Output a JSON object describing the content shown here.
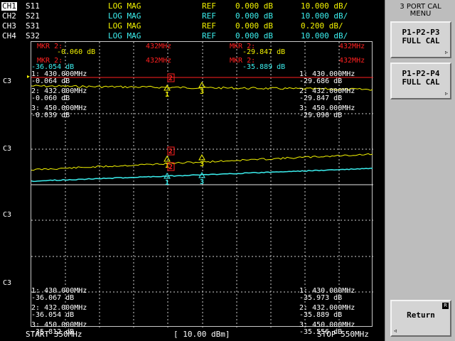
{
  "channels": [
    {
      "id": "CH1",
      "param": "S11",
      "format": "LOG MAG",
      "ref_label": "REF",
      "ref_value": "0.000 dB",
      "scale": "10.000 dB/",
      "color": "#f4f400"
    },
    {
      "id": "CH2",
      "param": "S21",
      "format": "LOG MAG",
      "ref_label": "REF",
      "ref_value": "0.000 dB",
      "scale": "10.000 dB/",
      "color": "#3cf0f0"
    },
    {
      "id": "CH3",
      "param": "S31",
      "format": "LOG MAG",
      "ref_label": "REF",
      "ref_value": "0.000 dB",
      "scale": "0.200 dB/",
      "color": "#f4f400"
    },
    {
      "id": "CH4",
      "param": "S32",
      "format": "LOG MAG",
      "ref_label": "REF",
      "ref_value": "0.000 dB",
      "scale": "10.000 dB/",
      "color": "#3cf0f0"
    }
  ],
  "active_markers": {
    "left_top": {
      "label": "MKR 2:",
      "freq": "432MHz",
      "value": "-0.060 dB"
    },
    "left_bottom": {
      "label": "MKR 2:",
      "freq": "432MHz",
      "value": "-36.054 dB"
    },
    "right_top": {
      "label": "MKR 2:",
      "freq": "432MHz",
      "value": "-29.847 dB"
    },
    "right_bottom": {
      "label": "MKR 2:",
      "freq": "432MHz",
      "value": "-35.889 dB"
    }
  },
  "marker_tables": {
    "top_left": [
      {
        "idx": "1:",
        "freq": "430.000MHz",
        "value": "-0.064 dB"
      },
      {
        "idx": "2:",
        "freq": "432.000MHz",
        "value": "-0.060 dB"
      },
      {
        "idx": "3:",
        "freq": "450.000MHz",
        "value": "-0.039 dB"
      }
    ],
    "top_right": [
      {
        "idx": "1:",
        "freq": "430.000MHz",
        "value": "-29.686 dB"
      },
      {
        "idx": "2:",
        "freq": "432.000MHz",
        "value": "-29.847 dB"
      },
      {
        "idx": "3:",
        "freq": "450.000MHz",
        "value": "-29.090 dB"
      }
    ],
    "bottom_left": [
      {
        "idx": "1:",
        "freq": "430.000MHz",
        "value": "-36.067 dB"
      },
      {
        "idx": "2:",
        "freq": "432.000MHz",
        "value": "-36.054 dB"
      },
      {
        "idx": "3:",
        "freq": "450.000MHz",
        "value": "-35.812 dB"
      }
    ],
    "bottom_right": [
      {
        "idx": "1:",
        "freq": "430.000MHz",
        "value": "-35.973 dB"
      },
      {
        "idx": "2:",
        "freq": "432.000MHz",
        "value": "-35.889 dB"
      },
      {
        "idx": "3:",
        "freq": "450.000MHz",
        "value": "-35.556 dB"
      }
    ]
  },
  "channel_tags": [
    "C3",
    "C3",
    "C3",
    "C3",
    "C3"
  ],
  "footer": {
    "start": "START 350MHz",
    "power": "[ 10.00 dBm]",
    "stop": "STOP 550MHz"
  },
  "menu": {
    "title_line1": "3 PORT CAL",
    "title_line2": "MENU",
    "softkeys": [
      {
        "line1": "P1-P2-P3",
        "line2": "FULL CAL",
        "badge": "",
        "arrow": "▹"
      },
      {
        "line1": "P1-P2-P4",
        "line2": "FULL CAL",
        "badge": "",
        "arrow": "▹"
      }
    ],
    "return_label": "Return",
    "return_badge": "R",
    "return_arrow": "◃"
  },
  "marker_symbols": [
    "1",
    "2",
    "3"
  ],
  "colors": {
    "trace_yellow": "#f4f400",
    "trace_cyan": "#3cf0f0",
    "marker_red": "#ff2020",
    "grid": "#d0d0d0",
    "reference_line": "#ff2020"
  }
}
